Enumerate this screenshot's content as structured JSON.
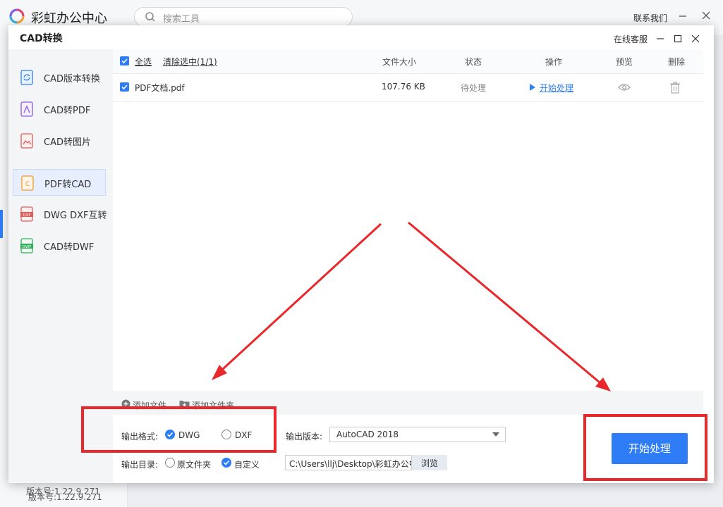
{
  "app": {
    "title": "彩虹办公中心",
    "search_placeholder": "搜索工具",
    "contact_label": "联系我们",
    "version": "版本号:1.22.9.271"
  },
  "dialog": {
    "title": "CAD转换",
    "service_label": "在线客服",
    "version": "版本号:1.22.9.271",
    "nav": [
      {
        "label": "CAD版本转换",
        "icon": "refresh-doc-icon",
        "active": false
      },
      {
        "label": "CAD转PDF",
        "icon": "pdf-doc-icon",
        "active": false
      },
      {
        "label": "CAD转图片",
        "icon": "image-doc-icon",
        "active": false
      },
      {
        "label": "PDF转CAD",
        "icon": "cad-doc-icon",
        "active": true
      },
      {
        "label": "DWG DXF互转",
        "icon": "dxf-doc-icon",
        "active": false
      },
      {
        "label": "CAD转DWF",
        "icon": "dwf-doc-icon",
        "active": false
      }
    ]
  },
  "file_list": {
    "select_all": "全选",
    "clear_selection": "清除选中(1/1)",
    "columns": {
      "size": "文件大小",
      "status": "状态",
      "action": "操作",
      "preview": "预览",
      "delete": "删除"
    },
    "rows": [
      {
        "name": "PDF文档.pdf",
        "size": "107.76 KB",
        "status": "待处理",
        "action": "开始处理",
        "checked": true
      }
    ],
    "add_file": "添加文件",
    "add_folder": "添加文件夹"
  },
  "output": {
    "format_label": "输出格式:",
    "formats": [
      {
        "label": "DWG",
        "selected": true
      },
      {
        "label": "DXF",
        "selected": false
      }
    ],
    "version_label": "输出版本:",
    "version_value": "AutoCAD 2018",
    "dir_label": "输出目录:",
    "dir_options": [
      {
        "label": "原文件夹",
        "selected": false
      },
      {
        "label": "自定义",
        "selected": true
      }
    ],
    "path_value": "C:\\Users\\llj\\Desktop\\彩虹办公中心",
    "browse_label": "浏览",
    "start_label": "开始处理"
  },
  "colors": {
    "accent": "#2f7df6",
    "annotation": "#e8282b"
  }
}
